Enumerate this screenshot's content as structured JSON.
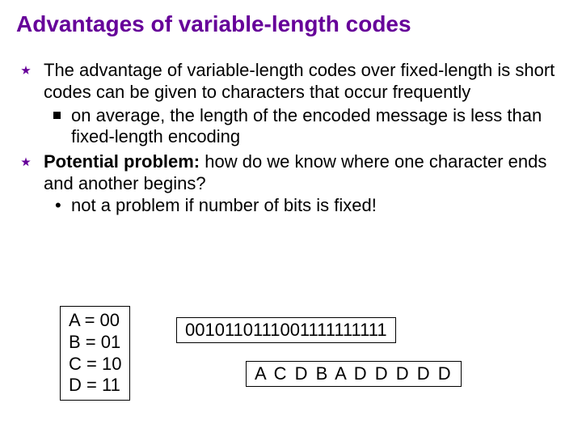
{
  "title": "Advantages of variable-length codes",
  "bullets": {
    "b1": "The advantage of variable-length codes over fixed-length is short codes can be given to characters that occur frequently",
    "b1_sub": "on average, the length of the encoded message is less than fixed-length encoding",
    "b2_label": "Potential problem:",
    "b2_rest": " how do we know where one character ends and another begins?",
    "b2_sub": "not a problem if number of bits is fixed!"
  },
  "codes": {
    "A": "A = 00",
    "B": "B = 01",
    "C": "C = 10",
    "D": "D = 11"
  },
  "bitstring": "0010110111001111111111",
  "decoded": "A C D B A D D D D D"
}
